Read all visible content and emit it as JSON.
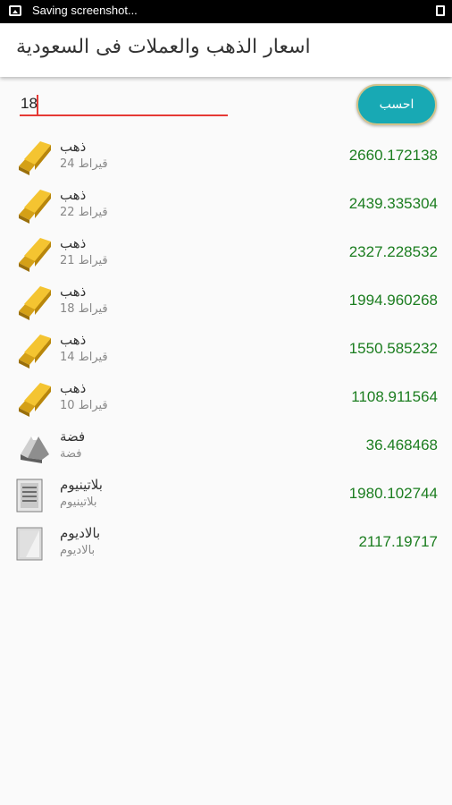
{
  "status_bar": {
    "text": "Saving screenshot..."
  },
  "app_bar": {
    "title": "اسعار الذهب والعملات فى السعودية"
  },
  "calculator": {
    "button_label": "احسب",
    "input_value": "18"
  },
  "items": [
    {
      "name": "ذهب",
      "sub": "24 قيراط",
      "price": "2660.172138",
      "icon": "gold-bar-icon"
    },
    {
      "name": "ذهب",
      "sub": "22 قيراط",
      "price": "2439.335304",
      "icon": "gold-bar-icon"
    },
    {
      "name": "ذهب",
      "sub": "21 قيراط",
      "price": "2327.228532",
      "icon": "gold-bar-icon"
    },
    {
      "name": "ذهب",
      "sub": "18 قيراط",
      "price": "1994.960268",
      "icon": "gold-bar-icon"
    },
    {
      "name": "ذهب",
      "sub": "14 قيراط",
      "price": "1550.585232",
      "icon": "gold-bar-icon"
    },
    {
      "name": "ذهب",
      "sub": "10 قيراط",
      "price": "1108.911564",
      "icon": "gold-bar-icon"
    },
    {
      "name": "فضة",
      "sub": "فضة",
      "price": "36.468468",
      "icon": "silver-bar-icon"
    },
    {
      "name": "بلاتينيوم",
      "sub": "بلاتينيوم",
      "price": "1980.102744",
      "icon": "platinum-bar-icon"
    },
    {
      "name": "بالاديوم",
      "sub": "بالاديوم",
      "price": "2117.19717",
      "icon": "palladium-bar-icon"
    }
  ],
  "colors": {
    "price": "#1b7d1f",
    "button": "#18a9b4",
    "input_underline": "#e53935"
  }
}
